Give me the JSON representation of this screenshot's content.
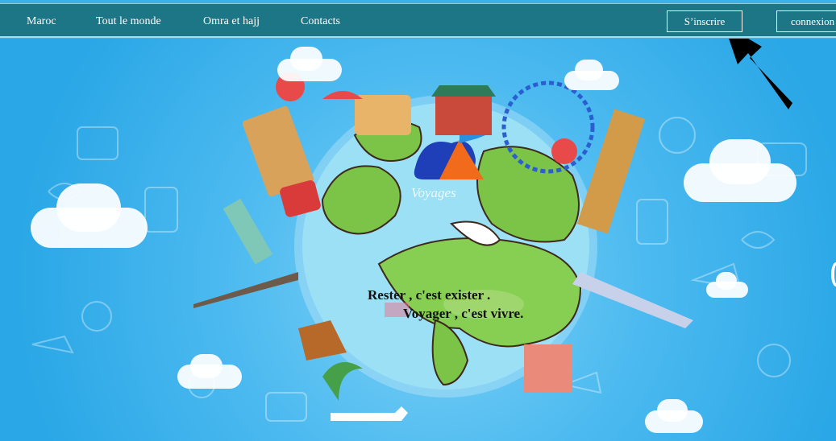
{
  "nav": {
    "links": [
      "Maroc",
      "Tout le monde",
      "Omra et hajj",
      "Contacts"
    ],
    "signup_label": "S’inscrire",
    "login_label": "connexion"
  },
  "hero": {
    "logo_text": "Voyages",
    "quote_line1": "Rester , c'est exister .",
    "quote_line2": "Voyager , c'est vivre."
  },
  "colors": {
    "navbar": "#1d7685",
    "sky": "#3bb3ea",
    "ocean": "#8fdcf2",
    "land": "#7cc448",
    "arrow": "#000000"
  }
}
